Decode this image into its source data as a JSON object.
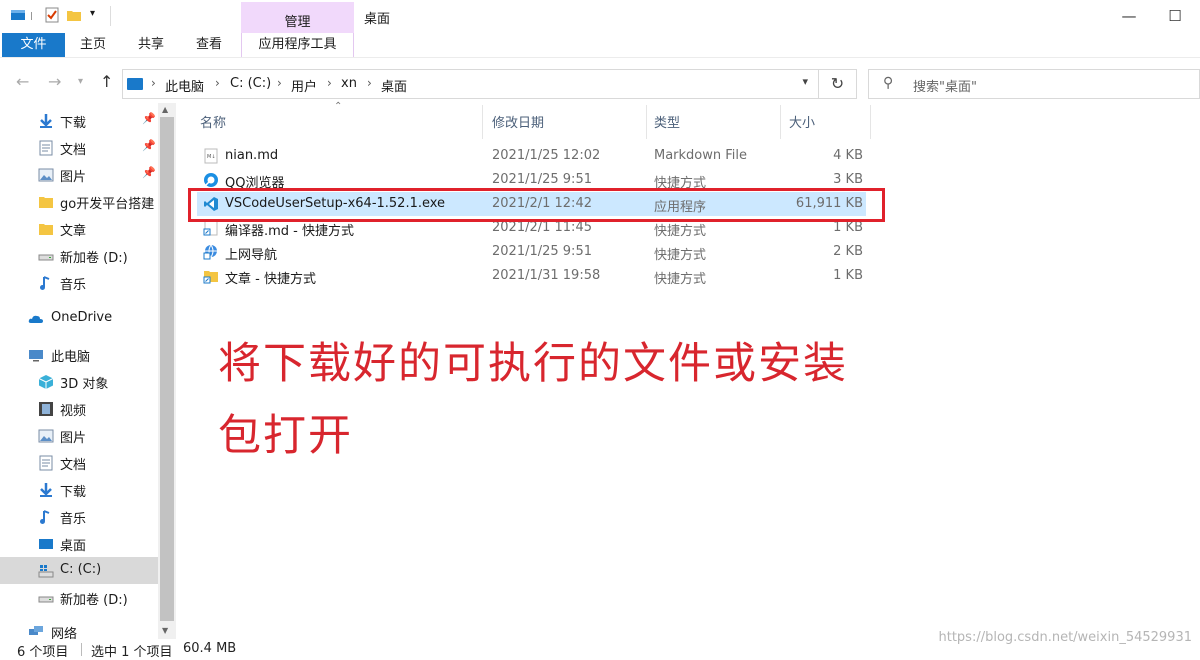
{
  "window": {
    "title": "桌面",
    "ribbon_context_group": "管理",
    "ribbon_context_tab": "应用程序工具",
    "tabs": [
      "文件",
      "主页",
      "共享",
      "查看"
    ]
  },
  "address": {
    "crumbs": [
      "此电脑",
      "C: (C:)",
      "用户",
      "xn",
      "桌面"
    ],
    "search_placeholder": "搜索\"桌面\""
  },
  "sidebar": {
    "quick_access": [
      {
        "label": "下载",
        "icon": "download-arrow-icon",
        "pinned": true
      },
      {
        "label": "文档",
        "icon": "document-icon",
        "pinned": true
      },
      {
        "label": "图片",
        "icon": "picture-icon",
        "pinned": true
      },
      {
        "label": "go开发平台搭建",
        "icon": "folder-icon",
        "pinned": false
      },
      {
        "label": "文章",
        "icon": "folder-icon",
        "pinned": false
      },
      {
        "label": "新加卷 (D:)",
        "icon": "drive-icon",
        "pinned": false
      },
      {
        "label": "音乐",
        "icon": "music-note-icon",
        "pinned": false
      }
    ],
    "onedrive": "OneDrive",
    "this_pc": "此电脑",
    "pc_items": [
      {
        "label": "3D 对象",
        "icon": "cube-3d-icon"
      },
      {
        "label": "视频",
        "icon": "film-icon"
      },
      {
        "label": "图片",
        "icon": "picture-icon"
      },
      {
        "label": "文档",
        "icon": "document-icon"
      },
      {
        "label": "下载",
        "icon": "download-arrow-icon"
      },
      {
        "label": "音乐",
        "icon": "music-note-icon"
      },
      {
        "label": "桌面",
        "icon": "desktop-icon"
      },
      {
        "label": "C: (C:)",
        "icon": "windows-drive-icon",
        "selected": true
      },
      {
        "label": "新加卷 (D:)",
        "icon": "drive-icon"
      }
    ],
    "network": "网络"
  },
  "columns": {
    "name": "名称",
    "date": "修改日期",
    "type": "类型",
    "size": "大小"
  },
  "files": [
    {
      "name": "nian.md",
      "date": "2021/1/25 12:02",
      "type": "Markdown File",
      "size": "4 KB",
      "icon": "markdown-file-icon"
    },
    {
      "name": "QQ浏览器",
      "date": "2021/1/25 9:51",
      "type": "快捷方式",
      "size": "3 KB",
      "icon": "qq-browser-icon"
    },
    {
      "name": "VSCodeUserSetup-x64-1.52.1.exe",
      "date": "2021/2/1 12:42",
      "type": "应用程序",
      "size": "61,911 KB",
      "icon": "vscode-icon",
      "selected": true
    },
    {
      "name": "编译器.md - 快捷方式",
      "date": "2021/2/1 11:45",
      "type": "快捷方式",
      "size": "1 KB",
      "icon": "shortcut-file-icon"
    },
    {
      "name": "上网导航",
      "date": "2021/1/25 9:51",
      "type": "快捷方式",
      "size": "2 KB",
      "icon": "web-shortcut-icon"
    },
    {
      "name": "文章 - 快捷方式",
      "date": "2021/1/31 19:58",
      "type": "快捷方式",
      "size": "1 KB",
      "icon": "folder-shortcut-icon"
    }
  ],
  "annotation": {
    "line1": "将下载好的可执行的文件或安装",
    "line2": "包打开",
    "color": "#d8262e"
  },
  "status": {
    "count": "6 个项目",
    "selection": "选中 1 个项目",
    "size": "60.4 MB"
  },
  "watermark": "https://blog.csdn.net/weixin_54529931",
  "colors": {
    "accent": "#1979ca",
    "selection": "#cce8ff",
    "context_tab": "#f1d9fb",
    "highlight_box": "#e0212b"
  }
}
